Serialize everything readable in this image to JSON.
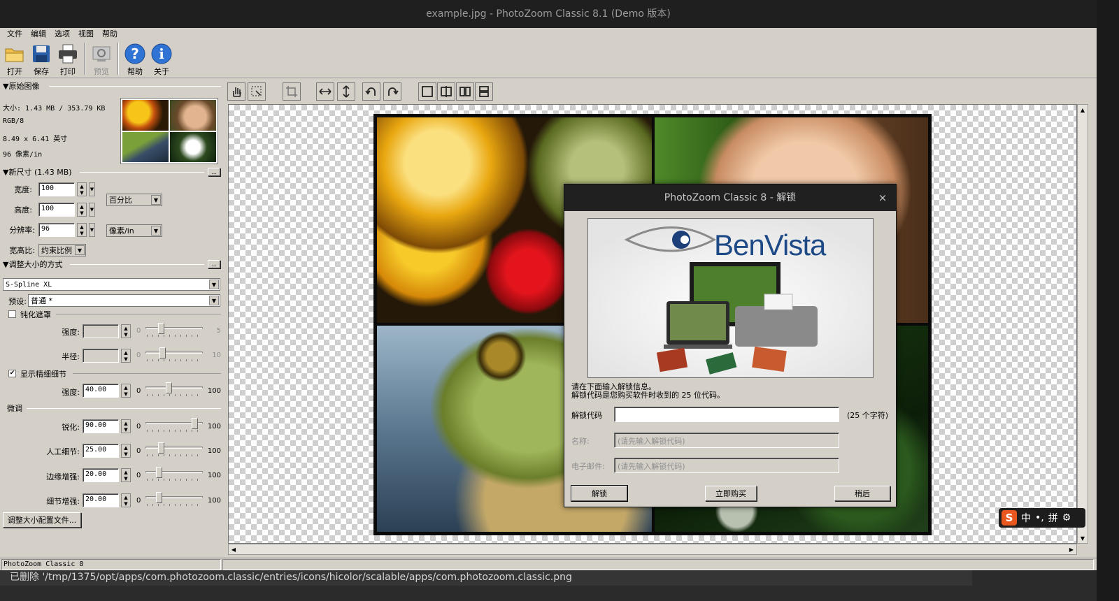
{
  "window": {
    "title": "example.jpg - PhotoZoom Classic 8.1 (Demo 版本)"
  },
  "menu": [
    "文件",
    "编辑",
    "选项",
    "视图",
    "帮助"
  ],
  "toolbar": {
    "open": "打开",
    "save": "保存",
    "print": "打印",
    "preview": "预览",
    "help": "帮助",
    "about": "关于"
  },
  "original_image": {
    "header": "原始图像",
    "size": "大小: 1.43 MB / 353.79 KB",
    "mode": "RGB/8",
    "dimensions": "8.49 x 6.41 英寸",
    "resolution": "96 像素/in"
  },
  "new_size": {
    "header": "新尺寸 (1.43 MB)",
    "width_label": "宽度:",
    "width_value": "100",
    "height_label": "高度:",
    "height_value": "100",
    "unit": "百分比",
    "res_label": "分辨率:",
    "res_value": "96",
    "res_unit": "像素/in",
    "aspect_label": "宽高比:",
    "aspect_value": "约束比例",
    "more_btn": "..."
  },
  "resize_method": {
    "header": "调整大小的方式",
    "method": "S-Spline XL",
    "preset_label": "预设:",
    "preset_value": "普通 *",
    "more_btn": "..."
  },
  "unsharp": {
    "label": "钝化遮罩",
    "checked": false,
    "strength_label": "强度:",
    "strength_min": "0",
    "strength_max": "5",
    "strength_level": 0.25,
    "radius_label": "半径:",
    "radius_min": "0",
    "radius_max": "10",
    "radius_level": 0.28
  },
  "fine_detail": {
    "label": "显示精细细节",
    "checked": true,
    "strength_label": "强度:",
    "strength_value": "40.00",
    "strength_min": "0",
    "strength_max": "100",
    "strength_level": 0.4
  },
  "fine_tune": {
    "header": "微调",
    "rows": [
      {
        "label": "锐化:",
        "value": "90.00",
        "min": "0",
        "max": "100",
        "level": 0.9
      },
      {
        "label": "人工细节:",
        "value": "25.00",
        "min": "0",
        "max": "100",
        "level": 0.25
      },
      {
        "label": "边缘增强:",
        "value": "20.00",
        "min": "0",
        "max": "100",
        "level": 0.2
      },
      {
        "label": "细节增强:",
        "value": "20.00",
        "min": "0",
        "max": "100",
        "level": 0.2
      }
    ]
  },
  "profile_button": "调整大小配置文件...",
  "status": {
    "left": "PhotoZoom Classic 8"
  },
  "notification": "已删除 '/tmp/1375/opt/apps/com.photozoom.classic/entries/icons/hicolor/scalable/apps/com.photozoom.classic.png",
  "dialog": {
    "title": "PhotoZoom Classic 8 - 解锁",
    "close": "×",
    "logo": "BenVista",
    "info1": "请在下面输入解锁信息。",
    "info2": "解锁代码是您购买软件时收到的 25 位代码。",
    "code_label": "解锁代码",
    "code_value": "",
    "code_hint": "(25 个字符)",
    "name_label": "名称:",
    "name_placeholder": "(请先输入解锁代码)",
    "email_label": "电子邮件:",
    "email_placeholder": "(请先输入解锁代码)",
    "unlock_btn": "解锁",
    "buy_btn": "立即购买",
    "later_btn": "稍后"
  },
  "ime": {
    "lang": "中",
    "punct": "•,",
    "mode": "拼"
  }
}
